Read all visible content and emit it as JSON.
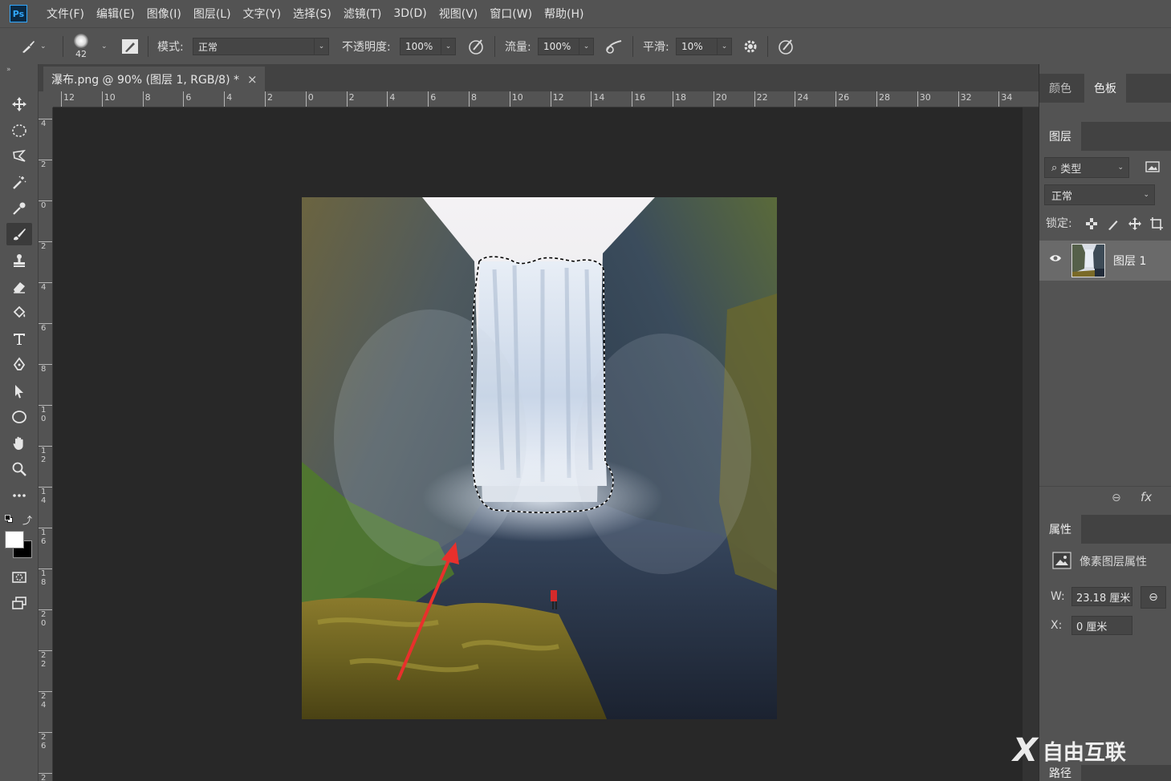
{
  "app": {
    "logo": "Ps",
    "menu": [
      "文件(F)",
      "编辑(E)",
      "图像(I)",
      "图层(L)",
      "文字(Y)",
      "选择(S)",
      "滤镜(T)",
      "3D(D)",
      "视图(V)",
      "窗口(W)",
      "帮助(H)"
    ]
  },
  "options": {
    "brush_size": "42",
    "mode_label": "模式:",
    "mode_value": "正常",
    "opacity_label": "不透明度:",
    "opacity_value": "100%",
    "flow_label": "流量:",
    "flow_value": "100%",
    "smooth_label": "平滑:",
    "smooth_value": "10%"
  },
  "tools": [
    "move-tool",
    "ellipse-marquee-tool",
    "lasso-tool",
    "magic-wand-tool",
    "eyedropper-tool",
    "brush-tool",
    "stamp-tool",
    "eraser-tool",
    "paint-bucket-tool",
    "type-tool",
    "pen-tool",
    "path-select-tool",
    "ellipse-shape-tool",
    "hand-tool",
    "zoom-tool",
    "more-tools",
    "default-colors",
    "swap-colors",
    "quick-mask",
    "screen-mode"
  ],
  "active_tool": "brush-tool",
  "document": {
    "tab_title": "瀑布.png @ 90% (图层 1, RGB/8) *",
    "close": "×",
    "hruler": [
      "12",
      "10",
      "8",
      "6",
      "4",
      "2",
      "0",
      "2",
      "4",
      "6",
      "8",
      "10",
      "12",
      "14",
      "16",
      "18",
      "20",
      "22",
      "24",
      "26",
      "28",
      "30",
      "32",
      "34"
    ],
    "vruler": [
      "4",
      "2",
      "0",
      "2",
      "4",
      "6",
      "8",
      "1\n0",
      "1\n2",
      "1\n4",
      "1\n6",
      "1\n8",
      "2\n0",
      "2\n2",
      "2\n4",
      "2\n6",
      "2"
    ]
  },
  "panels": {
    "top_tabs": [
      "颜色",
      "色板"
    ],
    "top_active": "色板",
    "layers_tab": "图层",
    "filter_label": "类型",
    "blend_mode": "正常",
    "lock_label": "锁定:",
    "layer_name": "图层 1",
    "properties_tab": "属性",
    "properties_title": "像素图层属性",
    "w_label": "W:",
    "w_value": "23.18 厘米",
    "x_label": "X:",
    "x_value": "0 厘米",
    "bottom_tab": "路径",
    "fx": "fx"
  },
  "watermark": {
    "mark": "X",
    "text": "自由互联"
  },
  "colors": {
    "ui_bg": "#535353",
    "canvas_bg": "#282828",
    "accent": "#31a8ff",
    "arrow": "#e8302c"
  }
}
